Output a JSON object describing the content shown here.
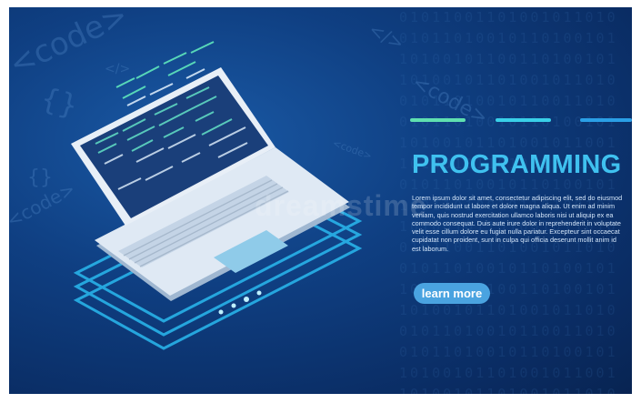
{
  "hero": {
    "title": "PROGRAMMING",
    "body": "Lorem ipsum dolor sit amet, consectetur adipiscing elit, sed do eiusmod tempor incididunt ut labore et dolore magna aliqua. Ut enim ad minim veniam, quis nostrud exercitation ullamco laboris nisi ut aliquip ex ea commodo consequat. Duis aute irure dolor in reprehenderit in voluptate velit esse cillum dolore eu fugiat nulla pariatur. Excepteur sint occaecat cupidatat non proident, sunt in culpa qui officia deserunt mollit anim id est laborum.",
    "button_label": "learn more"
  },
  "decor": {
    "code_word": "<code>",
    "slash_tag": "</>",
    "brace": "{}",
    "watermark": "dreamstime"
  },
  "colors": {
    "background": "#0f3f82",
    "title": "#3fc1ef",
    "button": "#4aa3e0",
    "accent_green": "#5fe0b0",
    "accent_cyan": "#39d0e8",
    "accent_blue": "#2a9fe6"
  },
  "icons": [
    "laptop-icon"
  ]
}
